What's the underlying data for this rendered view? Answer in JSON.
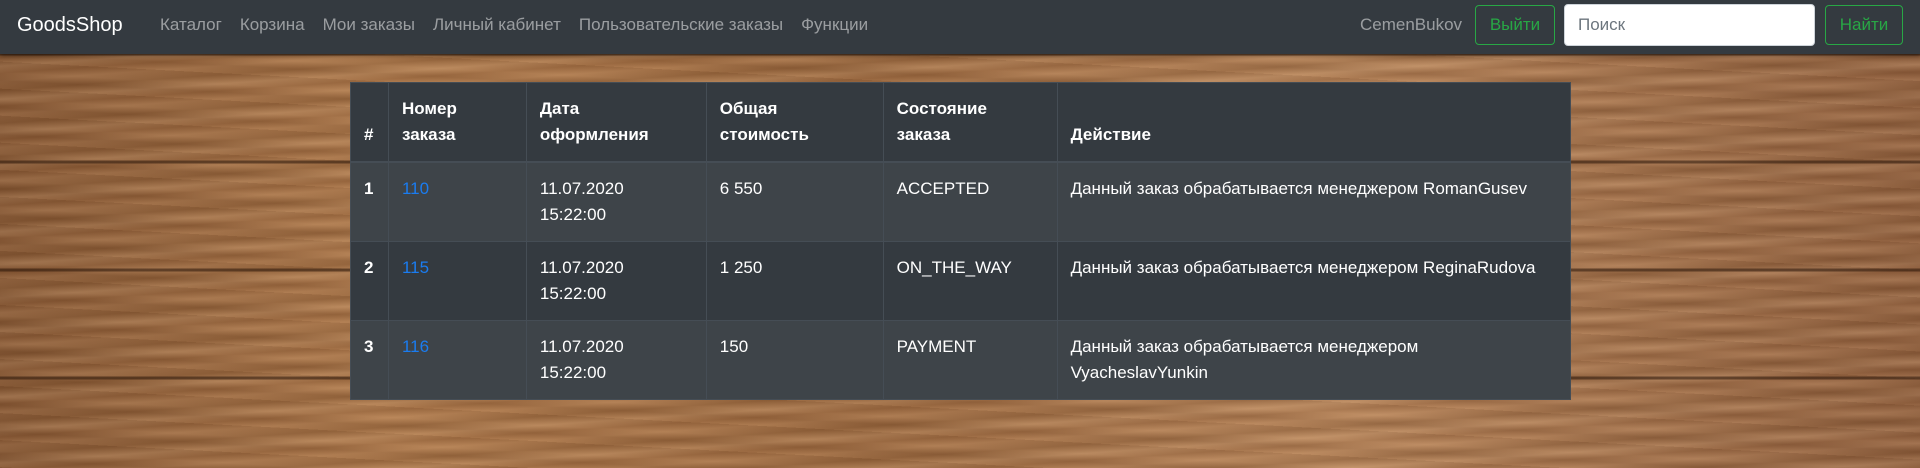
{
  "navbar": {
    "brand": "GoodsShop",
    "links": [
      {
        "label": "Каталог"
      },
      {
        "label": "Корзина"
      },
      {
        "label": "Мои заказы"
      },
      {
        "label": "Личный кабинет"
      },
      {
        "label": "Пользовательские заказы"
      },
      {
        "label": "Функции"
      }
    ],
    "username": "CemenBukov",
    "logout_label": "Выйти",
    "search_placeholder": "Поиск",
    "search_value": "",
    "search_button_label": "Найти"
  },
  "orders_table": {
    "headers": {
      "index": "#",
      "number_line1": "Номер",
      "number_line2": "заказа",
      "date_line1": "Дата",
      "date_line2": "оформления",
      "cost_line1": "Общая",
      "cost_line2": "стоимость",
      "state_line1": "Состояние",
      "state_line2": "заказа",
      "action": "Действие"
    },
    "rows": [
      {
        "index": "1",
        "number": "110",
        "date": "11.07.2020",
        "time": "15:22:00",
        "cost": "6 550",
        "state": "ACCEPTED",
        "action": "Данный заказ обрабатывается менеджером RomanGusev"
      },
      {
        "index": "2",
        "number": "115",
        "date": "11.07.2020",
        "time": "15:22:00",
        "cost": "1 250",
        "state": "ON_THE_WAY",
        "action": "Данный заказ обрабатывается менеджером ReginaRudova"
      },
      {
        "index": "3",
        "number": "116",
        "date": "11.07.2020",
        "time": "15:22:00",
        "cost": "150",
        "state": "PAYMENT",
        "action": "Данный заказ обрабатывается менеджером VyacheslavYunkin"
      }
    ]
  },
  "colors": {
    "navbar_bg": "#343a40",
    "table_bg": "#343a40",
    "accent_green": "#28a745",
    "link_blue": "#1a7cf0"
  }
}
